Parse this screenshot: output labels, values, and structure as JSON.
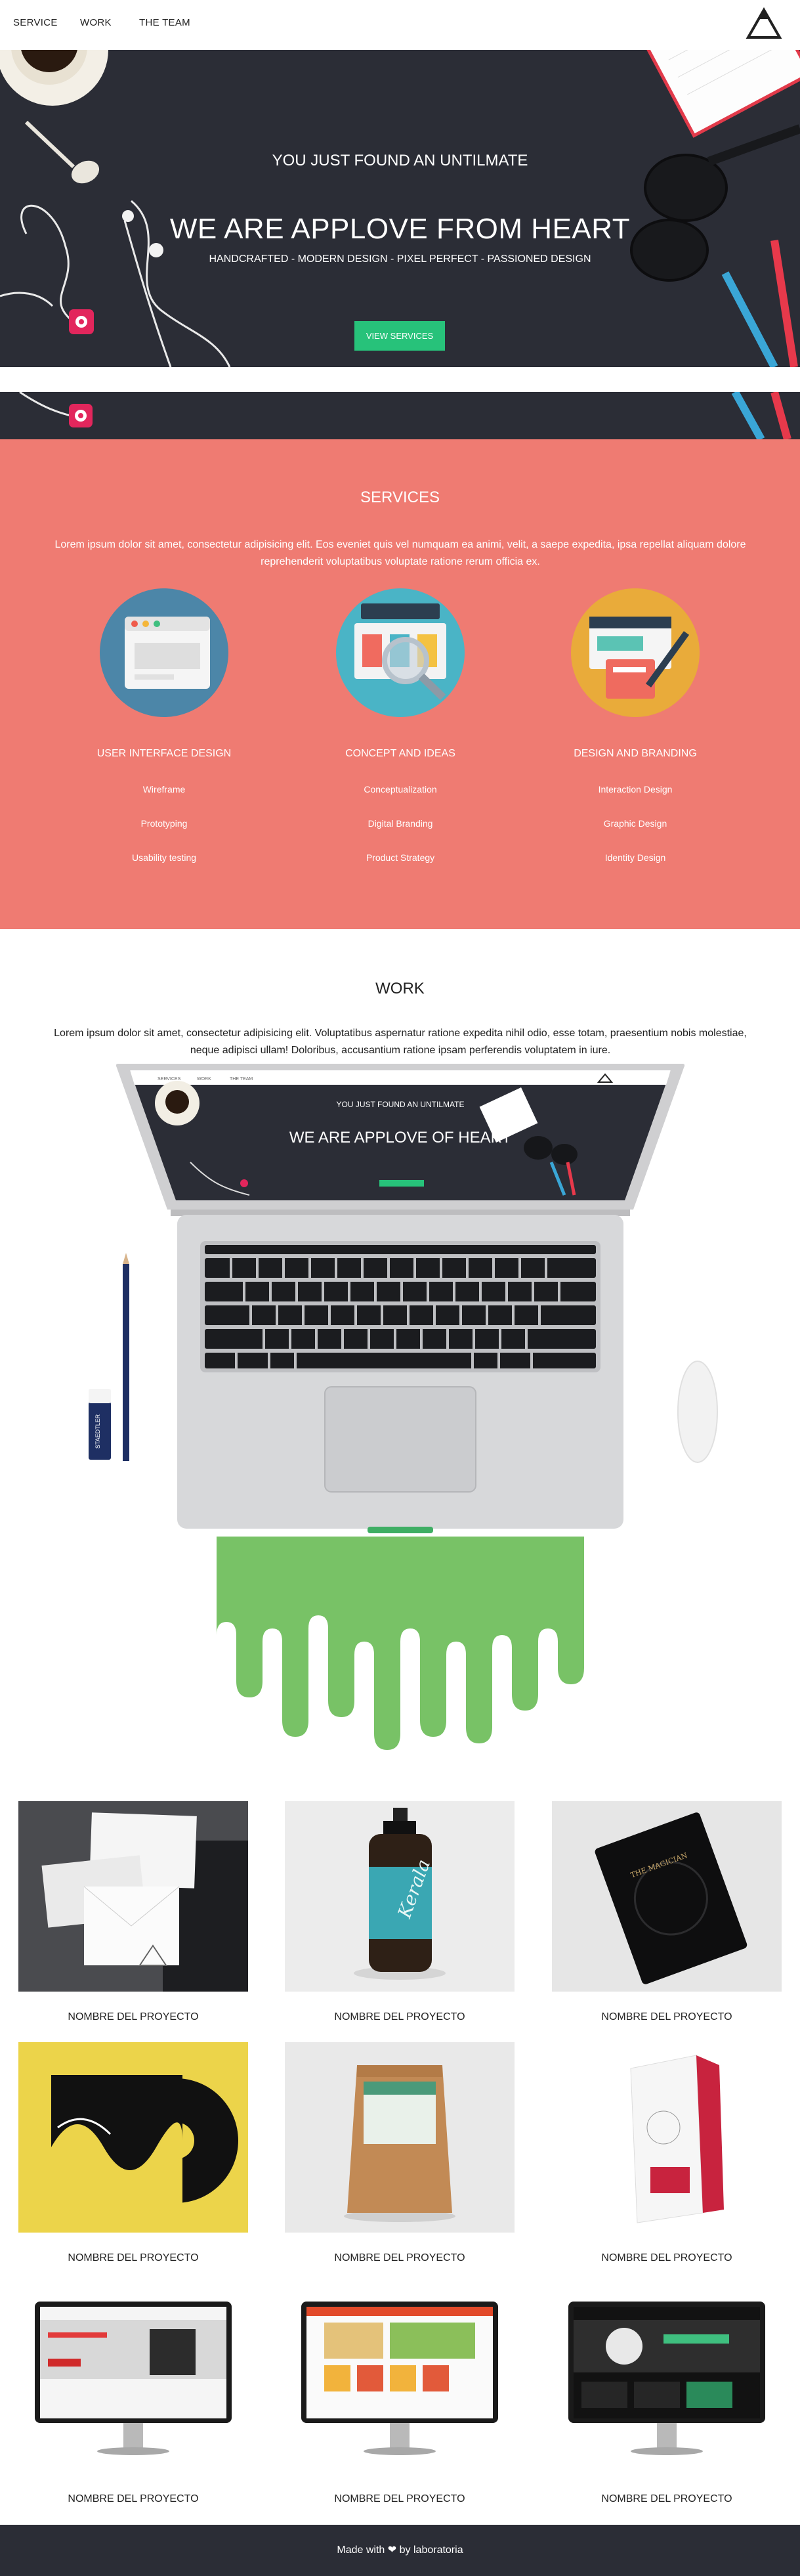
{
  "nav": {
    "items": [
      {
        "label": "SERVICE"
      },
      {
        "label": "WORK"
      },
      {
        "label": "THE TEAM"
      }
    ],
    "logo_icon": "triangle-logo-icon"
  },
  "hero": {
    "subtitle": "YOU JUST FOUND AN UNTILMATE",
    "title": "WE ARE APPLOVE FROM HEART",
    "tagline": "HANDCRAFTED - MODERN DESIGN - PIXEL PERFECT - PASSIONED DESIGN",
    "button": "VIEW SERVICES",
    "bg_color": "#2b2d36",
    "accent": "#27c27a"
  },
  "services": {
    "title": "SERVICES",
    "description": "Lorem ipsum dolor sit amet, consectetur adipisicing elit. Eos eveniet quis vel numquam ea animi, velit, a saepe expedita, ipsa repellat aliquam dolore reprehenderit voluptatibus voluptate ratione rerum officia ex.",
    "bg_color": "#ef7b72",
    "columns": [
      {
        "title": "USER INTERFACE DESIGN",
        "icon": "browser-window-icon",
        "items": [
          "Wireframe",
          "Prototyping",
          "Usability testing"
        ]
      },
      {
        "title": "CONCEPT AND IDEAS",
        "icon": "magnifier-chart-icon",
        "items": [
          "Conceptualization",
          "Digital Branding",
          "Product Strategy"
        ]
      },
      {
        "title": "DESIGN AND BRANDING",
        "icon": "brand-cards-pen-icon",
        "items": [
          "Interaction Design",
          "Graphic Design",
          "Identity Design"
        ]
      }
    ]
  },
  "work": {
    "title": "WORK",
    "description": "Lorem ipsum dolor sit amet, consectetur adipisicing elit. Voluptatibus aspernatur ratione expedita nihil odio, esse totam, praesentium nobis molestiae, neque adipisci ullam! Doloribus, accusantium ratione ipsam perferendis voluptatem in iure.",
    "laptop_screen": {
      "nav": [
        "SERVICES",
        "WORK",
        "THE TEAM"
      ],
      "subtitle": "YOU JUST FOUND AN UNTILMATE",
      "title": "WE ARE APPLOVE OF HEART"
    },
    "eraser_brand": "STAEDTLER",
    "projects": [
      {
        "label": "NOMBRE DEL PROYECTO",
        "image": "stationery-mockup"
      },
      {
        "label": "NOMBRE DEL PROYECTO",
        "image": "bottle-mockup"
      },
      {
        "label": "NOMBRE DEL PROYECTO",
        "image": "book-mockup"
      },
      {
        "label": "NOMBRE DEL PROYECTO",
        "image": "vinyl-mockup"
      },
      {
        "label": "NOMBRE DEL PROYECTO",
        "image": "pouch-mockup"
      },
      {
        "label": "NOMBRE DEL PROYECTO",
        "image": "box-mockup"
      },
      {
        "label": "NOMBRE DEL PROYECTO",
        "image": "website-monitor-1"
      },
      {
        "label": "NOMBRE DEL PROYECTO",
        "image": "website-monitor-2"
      },
      {
        "label": "NOMBRE DEL PROYECTO",
        "image": "website-monitor-3"
      }
    ]
  },
  "footer": {
    "prefix": "Made with",
    "heart_icon": "heart-icon",
    "suffix": "by laboratoria"
  }
}
